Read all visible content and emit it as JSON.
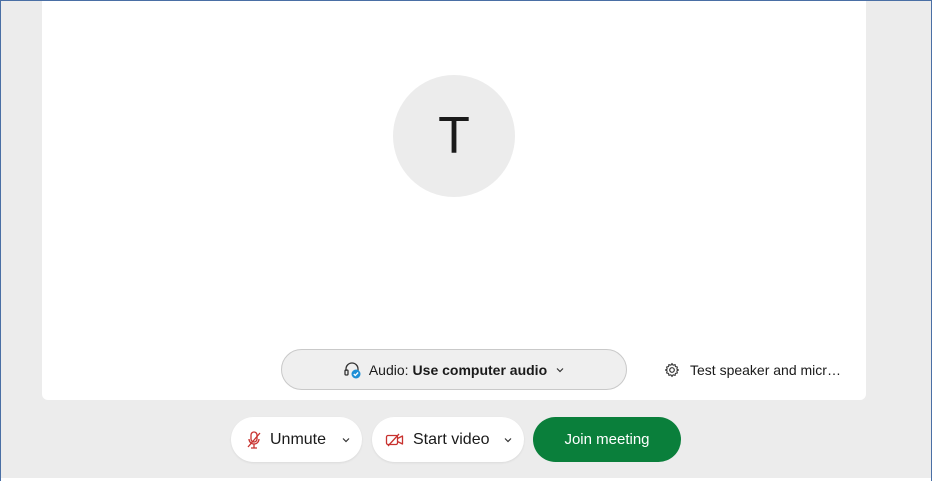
{
  "colors": {
    "background": "#ececec",
    "card": "#ffffff",
    "join_button": "#0a7f3b",
    "muted_icon": "#c8322f",
    "audio_badge": "#1d8fd6"
  },
  "preview": {
    "avatar_initial": "T"
  },
  "audio": {
    "label": "Audio:",
    "value": "Use computer audio",
    "icon": "headset-icon",
    "dropdown_icon": "chevron-down-icon"
  },
  "test_link": {
    "label": "Test speaker and micr…",
    "icon": "gear-icon"
  },
  "controls": {
    "unmute_label": "Unmute",
    "unmute_icon": "microphone-muted-icon",
    "start_video_label": "Start video",
    "start_video_icon": "video-off-icon",
    "join_label": "Join meeting"
  }
}
